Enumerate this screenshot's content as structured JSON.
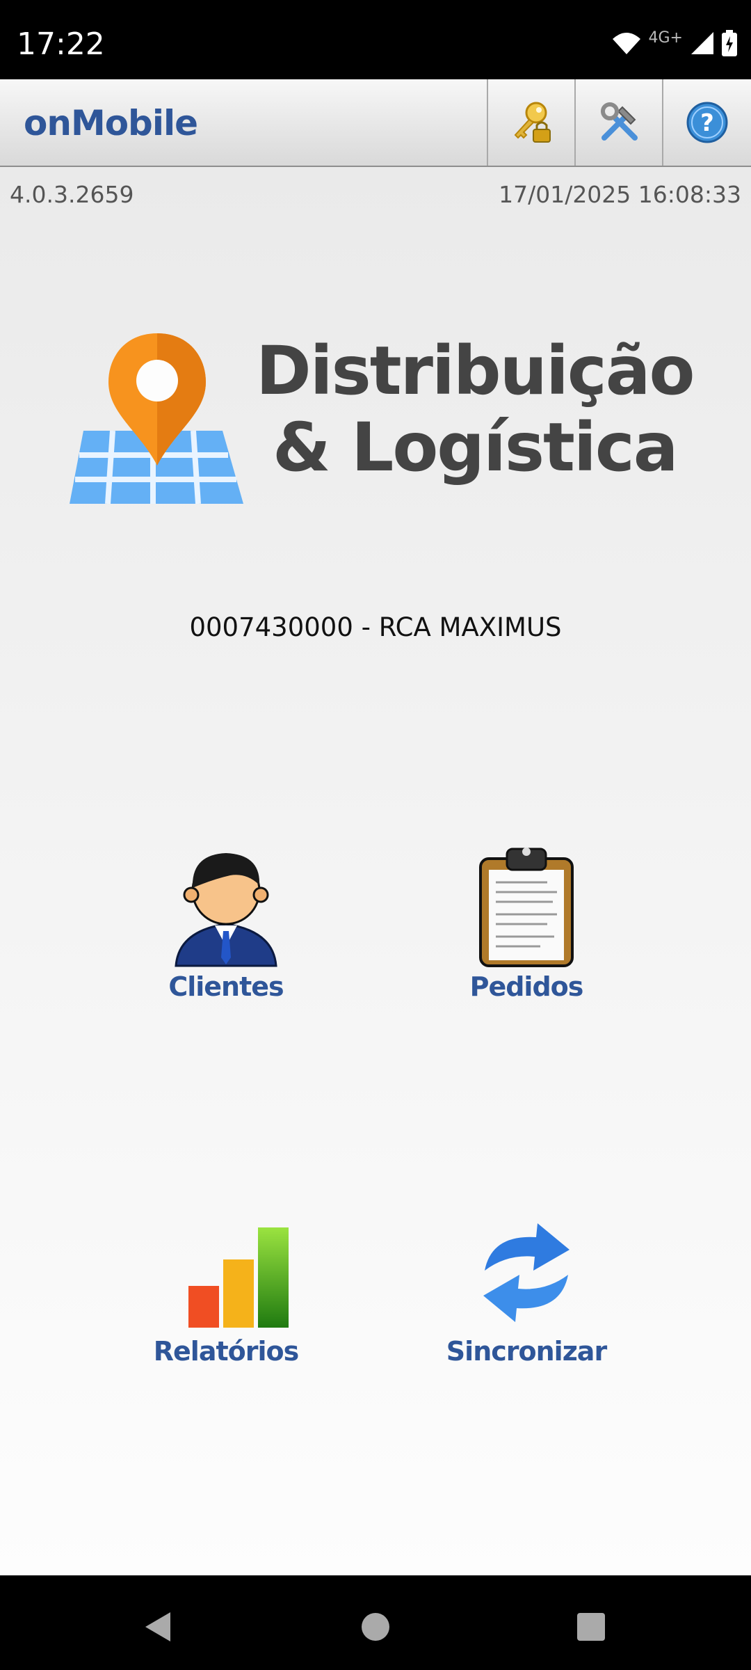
{
  "status_bar": {
    "time": "17:22",
    "network": "4G+"
  },
  "toolbar": {
    "title": "onMobile"
  },
  "info": {
    "version": "4.0.3.2659",
    "datetime": "17/01/2025 16:08:33"
  },
  "logo": {
    "line1": "Distribuição",
    "line2": "& Logística"
  },
  "user": {
    "label": "0007430000 - RCA MAXIMUS"
  },
  "tiles": [
    {
      "label": "Clientes"
    },
    {
      "label": "Pedidos"
    },
    {
      "label": "Relatórios"
    },
    {
      "label": "Sincronizar"
    }
  ],
  "colors": {
    "accent": "#2f5699",
    "pin": "#f7931e",
    "map": "#5aaaf5"
  }
}
